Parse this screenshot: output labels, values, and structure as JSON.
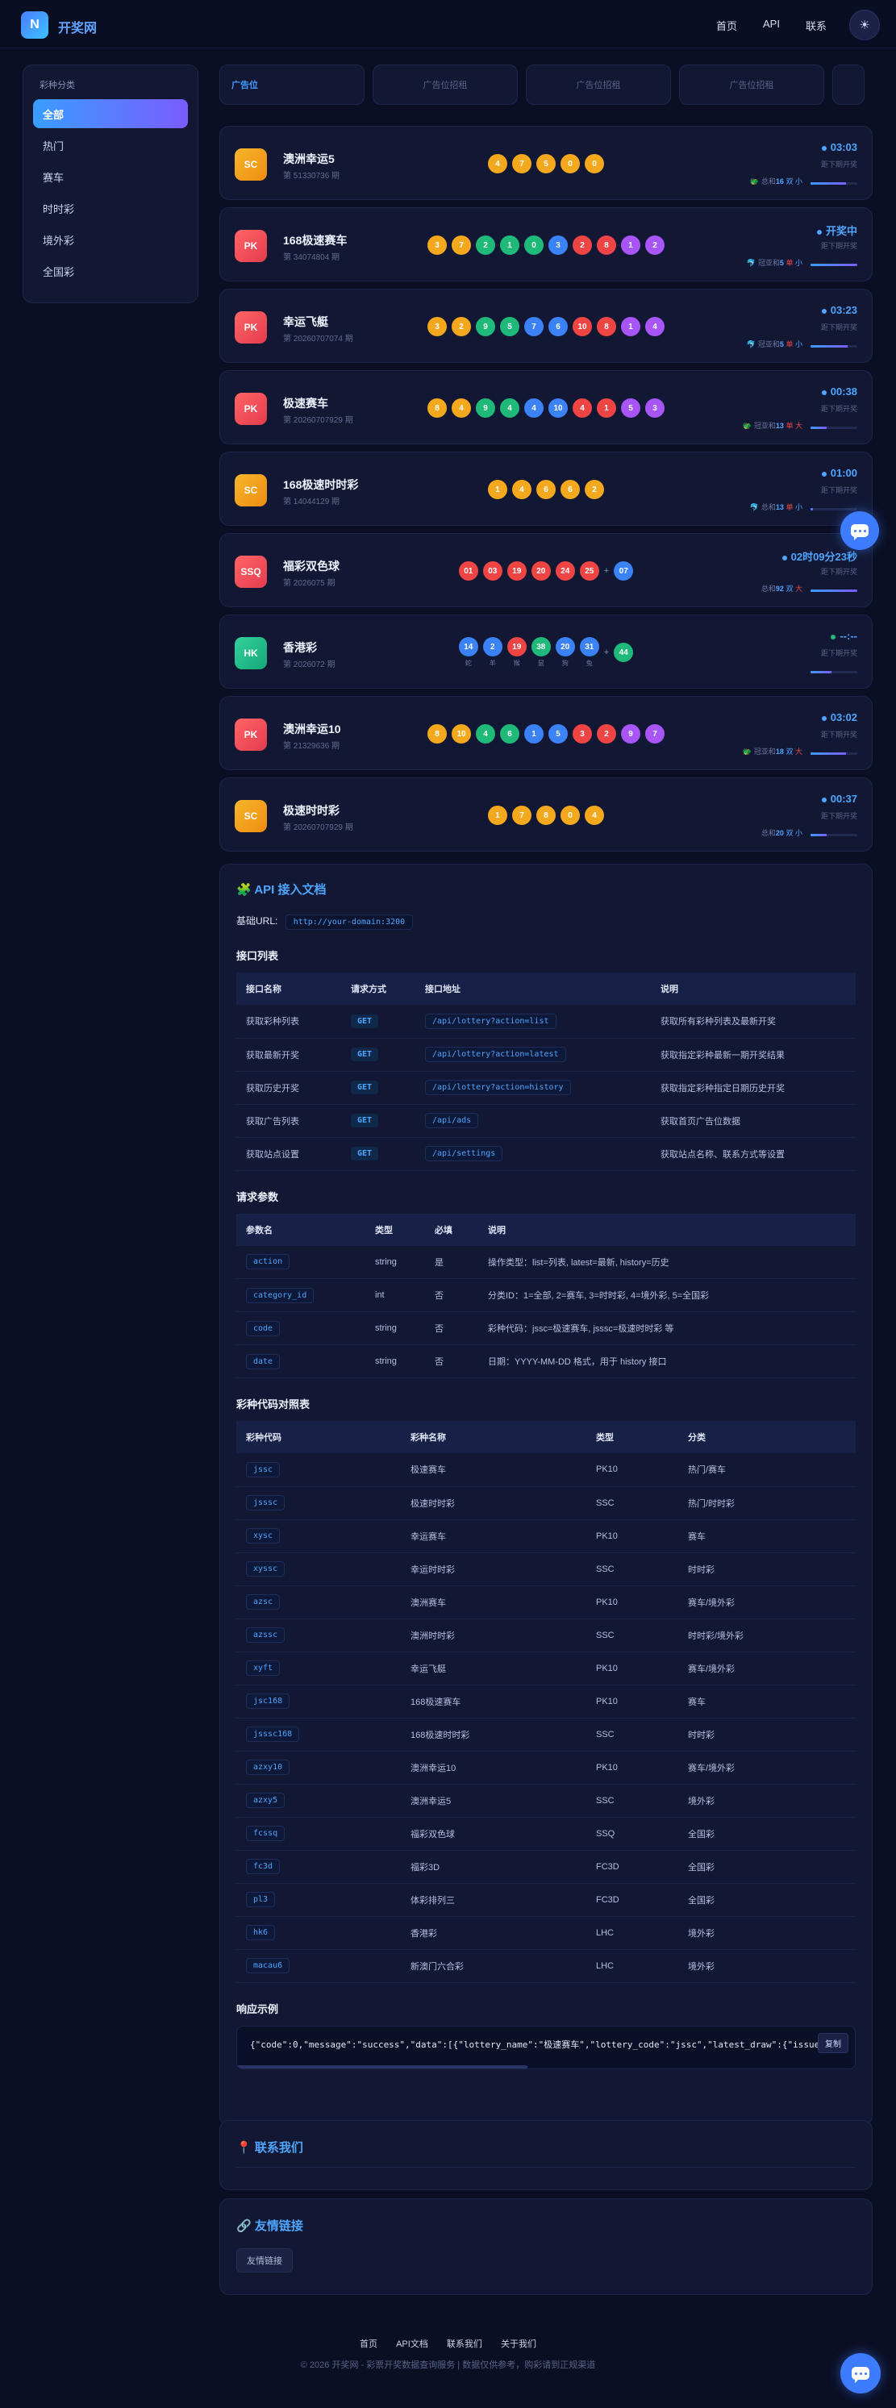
{
  "header": {
    "logo_letter": "N",
    "site_name": "开奖网",
    "nav": [
      "首页",
      "API",
      "联系"
    ]
  },
  "sidebar": {
    "title": "彩种分类",
    "items": [
      {
        "label": "全部",
        "active": true
      },
      {
        "label": "热门",
        "active": false
      },
      {
        "label": "赛车",
        "active": false
      },
      {
        "label": "时时彩",
        "active": false
      },
      {
        "label": "境外彩",
        "active": false
      },
      {
        "label": "全国彩",
        "active": false
      }
    ]
  },
  "ads": [
    "广告位",
    "广告位招租",
    "广告位招租",
    "广告位招租"
  ],
  "lotteries": [
    {
      "code": "SC",
      "color": "orange",
      "name": "澳洲幸运5",
      "period": "第 51330736 期",
      "balls": [
        {
          "n": "4",
          "c": "o"
        },
        {
          "n": "7",
          "c": "o"
        },
        {
          "n": "5",
          "c": "o"
        },
        {
          "n": "0",
          "c": "o"
        },
        {
          "n": "0",
          "c": "o"
        }
      ],
      "countdown": "03:03",
      "next": "距下期开奖",
      "stat_icon": "🐲",
      "stat_pre": "总和",
      "stat_num": "16",
      "stat_a": "双",
      "stat_b": "小",
      "progress": 0.75
    },
    {
      "code": "PK",
      "color": "red",
      "name": "168极速赛车",
      "period": "第 34074804 期",
      "balls": [
        {
          "n": "3",
          "c": "o"
        },
        {
          "n": "7",
          "c": "o"
        },
        {
          "n": "2",
          "c": "g"
        },
        {
          "n": "1",
          "c": "g"
        },
        {
          "n": "0",
          "c": "g"
        },
        {
          "n": "3",
          "c": "b"
        },
        {
          "n": "2",
          "c": "r"
        },
        {
          "n": "8",
          "c": "r"
        },
        {
          "n": "1",
          "c": "p"
        },
        {
          "n": "2",
          "c": "p"
        }
      ],
      "countdown": "开奖中",
      "next": "距下期开奖",
      "stat_icon": "🐬",
      "stat_pre": "冠亚和",
      "stat_num": "5",
      "stat_a": "单",
      "stat_b": "小",
      "progress": 1.0
    },
    {
      "code": "PK",
      "color": "red",
      "name": "幸运飞艇",
      "period": "第 20260707074 期",
      "balls": [
        {
          "n": "3",
          "c": "o"
        },
        {
          "n": "2",
          "c": "o"
        },
        {
          "n": "9",
          "c": "g"
        },
        {
          "n": "5",
          "c": "g"
        },
        {
          "n": "7",
          "c": "b"
        },
        {
          "n": "6",
          "c": "b"
        },
        {
          "n": "10",
          "c": "r"
        },
        {
          "n": "8",
          "c": "r"
        },
        {
          "n": "1",
          "c": "p"
        },
        {
          "n": "4",
          "c": "p"
        }
      ],
      "countdown": "03:23",
      "next": "距下期开奖",
      "stat_icon": "🐬",
      "stat_pre": "冠亚和",
      "stat_num": "5",
      "stat_a": "单",
      "stat_b": "小",
      "progress": 0.8
    },
    {
      "code": "PK",
      "color": "red",
      "name": "极速赛车",
      "period": "第 20260707929 期",
      "balls": [
        {
          "n": "8",
          "c": "o"
        },
        {
          "n": "4",
          "c": "o"
        },
        {
          "n": "9",
          "c": "g"
        },
        {
          "n": "4",
          "c": "g"
        },
        {
          "n": "4",
          "c": "b"
        },
        {
          "n": "10",
          "c": "b"
        },
        {
          "n": "4",
          "c": "r"
        },
        {
          "n": "1",
          "c": "r"
        },
        {
          "n": "5",
          "c": "p"
        },
        {
          "n": "3",
          "c": "p"
        }
      ],
      "countdown": "00:38",
      "next": "距下期开奖",
      "stat_icon": "🐲",
      "stat_pre": "冠亚和",
      "stat_num": "13",
      "stat_a": "单",
      "stat_b": "大",
      "progress": 0.35
    },
    {
      "code": "SC",
      "color": "orange",
      "name": "168极速时时彩",
      "period": "第 14044129 期",
      "balls": [
        {
          "n": "1",
          "c": "o"
        },
        {
          "n": "4",
          "c": "o"
        },
        {
          "n": "6",
          "c": "o"
        },
        {
          "n": "6",
          "c": "o"
        },
        {
          "n": "2",
          "c": "o"
        }
      ],
      "countdown": "01:00",
      "next": "距下期开奖",
      "stat_icon": "🐬",
      "stat_pre": "总和",
      "stat_num": "13",
      "stat_a": "单",
      "stat_b": "小",
      "progress": 0.05
    },
    {
      "code": "SSQ",
      "color": "red",
      "name": "福彩双色球",
      "period": "第 2026075 期",
      "balls": [
        {
          "n": "01",
          "c": "r"
        },
        {
          "n": "03",
          "c": "r"
        },
        {
          "n": "19",
          "c": "r"
        },
        {
          "n": "20",
          "c": "r"
        },
        {
          "n": "24",
          "c": "r"
        },
        {
          "n": "25",
          "c": "r"
        },
        {
          "n": "+",
          "c": "plus"
        },
        {
          "n": "07",
          "c": "b"
        }
      ],
      "countdown": "02时09分23秒",
      "next": "距下期开奖",
      "stat_icon": "",
      "stat_pre": "总和",
      "stat_num": "92",
      "stat_a": "双",
      "stat_b": "大",
      "progress": 1.0
    },
    {
      "code": "HK",
      "color": "green",
      "name": "香港彩",
      "period": "第 2026072 期",
      "balls": [
        {
          "n": "14",
          "c": "b",
          "z": "蛇"
        },
        {
          "n": "2",
          "c": "b",
          "z": "羊"
        },
        {
          "n": "19",
          "c": "r",
          "z": "猴"
        },
        {
          "n": "38",
          "c": "g",
          "z": "鼠"
        },
        {
          "n": "20",
          "c": "b",
          "z": "狗"
        },
        {
          "n": "31",
          "c": "b",
          "z": "兔"
        },
        {
          "n": "+",
          "c": "plus"
        },
        {
          "n": "44",
          "c": "g"
        }
      ],
      "countdown": "--:--",
      "next": "距下期开奖",
      "stat_icon": "",
      "stat_pre": "",
      "stat_num": "",
      "stat_a": "",
      "stat_b": "",
      "progress": 0.45
    },
    {
      "code": "PK",
      "color": "red",
      "name": "澳洲幸运10",
      "period": "第 21329636 期",
      "balls": [
        {
          "n": "8",
          "c": "o"
        },
        {
          "n": "10",
          "c": "o"
        },
        {
          "n": "4",
          "c": "g"
        },
        {
          "n": "6",
          "c": "g"
        },
        {
          "n": "1",
          "c": "b"
        },
        {
          "n": "5",
          "c": "b"
        },
        {
          "n": "3",
          "c": "r"
        },
        {
          "n": "2",
          "c": "r"
        },
        {
          "n": "9",
          "c": "p"
        },
        {
          "n": "7",
          "c": "p"
        }
      ],
      "countdown": "03:02",
      "next": "距下期开奖",
      "stat_icon": "🐲",
      "stat_pre": "冠亚和",
      "stat_num": "18",
      "stat_a": "双",
      "stat_b": "大",
      "progress": 0.75
    },
    {
      "code": "SC",
      "color": "orange",
      "name": "极速时时彩",
      "period": "第 20260707929 期",
      "balls": [
        {
          "n": "1",
          "c": "o"
        },
        {
          "n": "7",
          "c": "o"
        },
        {
          "n": "8",
          "c": "o"
        },
        {
          "n": "0",
          "c": "o"
        },
        {
          "n": "4",
          "c": "o"
        }
      ],
      "countdown": "00:37",
      "next": "距下期开奖",
      "stat_icon": "",
      "stat_pre": "总和",
      "stat_num": "20",
      "stat_a": "双",
      "stat_b": "小",
      "progress": 0.35
    }
  ],
  "api": {
    "title": "API 接入文档",
    "base_url_label": "基础URL:",
    "base_url": "http://your-domain:3200",
    "endpoints_title": "接口列表",
    "endpoints_headers": [
      "接口名称",
      "请求方式",
      "接口地址",
      "说明"
    ],
    "endpoints": [
      [
        "获取彩种列表",
        "GET",
        "/api/lottery?action=list",
        "获取所有彩种列表及最新开奖"
      ],
      [
        "获取最新开奖",
        "GET",
        "/api/lottery?action=latest",
        "获取指定彩种最新一期开奖结果"
      ],
      [
        "获取历史开奖",
        "GET",
        "/api/lottery?action=history",
        "获取指定彩种指定日期历史开奖"
      ],
      [
        "获取广告列表",
        "GET",
        "/api/ads",
        "获取首页广告位数据"
      ],
      [
        "获取站点设置",
        "GET",
        "/api/settings",
        "获取站点名称、联系方式等设置"
      ]
    ],
    "params_title": "请求参数",
    "params_headers": [
      "参数名",
      "类型",
      "必填",
      "说明"
    ],
    "params": [
      [
        "action",
        "string",
        "是",
        "操作类型：list=列表, latest=最新, history=历史"
      ],
      [
        "category_id",
        "int",
        "否",
        "分类ID：1=全部, 2=赛车, 3=时时彩, 4=境外彩, 5=全国彩"
      ],
      [
        "code",
        "string",
        "否",
        "彩种代码：jssc=极速赛车, jsssc=极速时时彩 等"
      ],
      [
        "date",
        "string",
        "否",
        "日期：YYYY-MM-DD 格式，用于 history 接口"
      ]
    ],
    "codes_title": "彩种代码对照表",
    "codes_headers": [
      "彩种代码",
      "彩种名称",
      "类型",
      "分类"
    ],
    "codes": [
      [
        "jssc",
        "极速赛车",
        "PK10",
        "热门/赛车"
      ],
      [
        "jsssc",
        "极速时时彩",
        "SSC",
        "热门/时时彩"
      ],
      [
        "xysc",
        "幸运赛车",
        "PK10",
        "赛车"
      ],
      [
        "xyssc",
        "幸运时时彩",
        "SSC",
        "时时彩"
      ],
      [
        "azsc",
        "澳洲赛车",
        "PK10",
        "赛车/境外彩"
      ],
      [
        "azssc",
        "澳洲时时彩",
        "SSC",
        "时时彩/境外彩"
      ],
      [
        "xyft",
        "幸运飞艇",
        "PK10",
        "赛车/境外彩"
      ],
      [
        "jsc168",
        "168极速赛车",
        "PK10",
        "赛车"
      ],
      [
        "jsssc168",
        "168极速时时彩",
        "SSC",
        "时时彩"
      ],
      [
        "azxy10",
        "澳洲幸运10",
        "PK10",
        "赛车/境外彩"
      ],
      [
        "azxy5",
        "澳洲幸运5",
        "SSC",
        "境外彩"
      ],
      [
        "fcssq",
        "福彩双色球",
        "SSQ",
        "全国彩"
      ],
      [
        "fc3d",
        "福彩3D",
        "FC3D",
        "全国彩"
      ],
      [
        "pl3",
        "体彩排列三",
        "FC3D",
        "全国彩"
      ],
      [
        "hk6",
        "香港彩",
        "LHC",
        "境外彩"
      ],
      [
        "macau6",
        "新澳门六合彩",
        "LHC",
        "境外彩"
      ]
    ],
    "response_title": "响应示例",
    "response_text": "{\"code\":0,\"message\":\"success\",\"data\":[{\"lottery_name\":\"极速赛车\",\"lottery_code\":\"jssc\",\"latest_draw\":{\"issue\":\"",
    "copy_label": "复制"
  },
  "contact": {
    "title": "联系我们"
  },
  "links": {
    "title": "友情链接",
    "items": [
      "友情链接"
    ]
  },
  "footer": {
    "nav": [
      "首页",
      "API文档",
      "联系我们",
      "关于我们"
    ],
    "copyright": "© 2026 开奖网 - 彩票开奖数据查询服务 | 数据仅供参考，购彩请到正规渠道"
  },
  "colors": {
    "accent": "#4ea6ff",
    "bg": "#0b0f24",
    "card": "#121834",
    "ball_orange": "#f4a81d",
    "ball_green": "#1fb97a",
    "ball_blue": "#3b82f6",
    "ball_red": "#ef4444",
    "ball_purple": "#a855f7"
  }
}
